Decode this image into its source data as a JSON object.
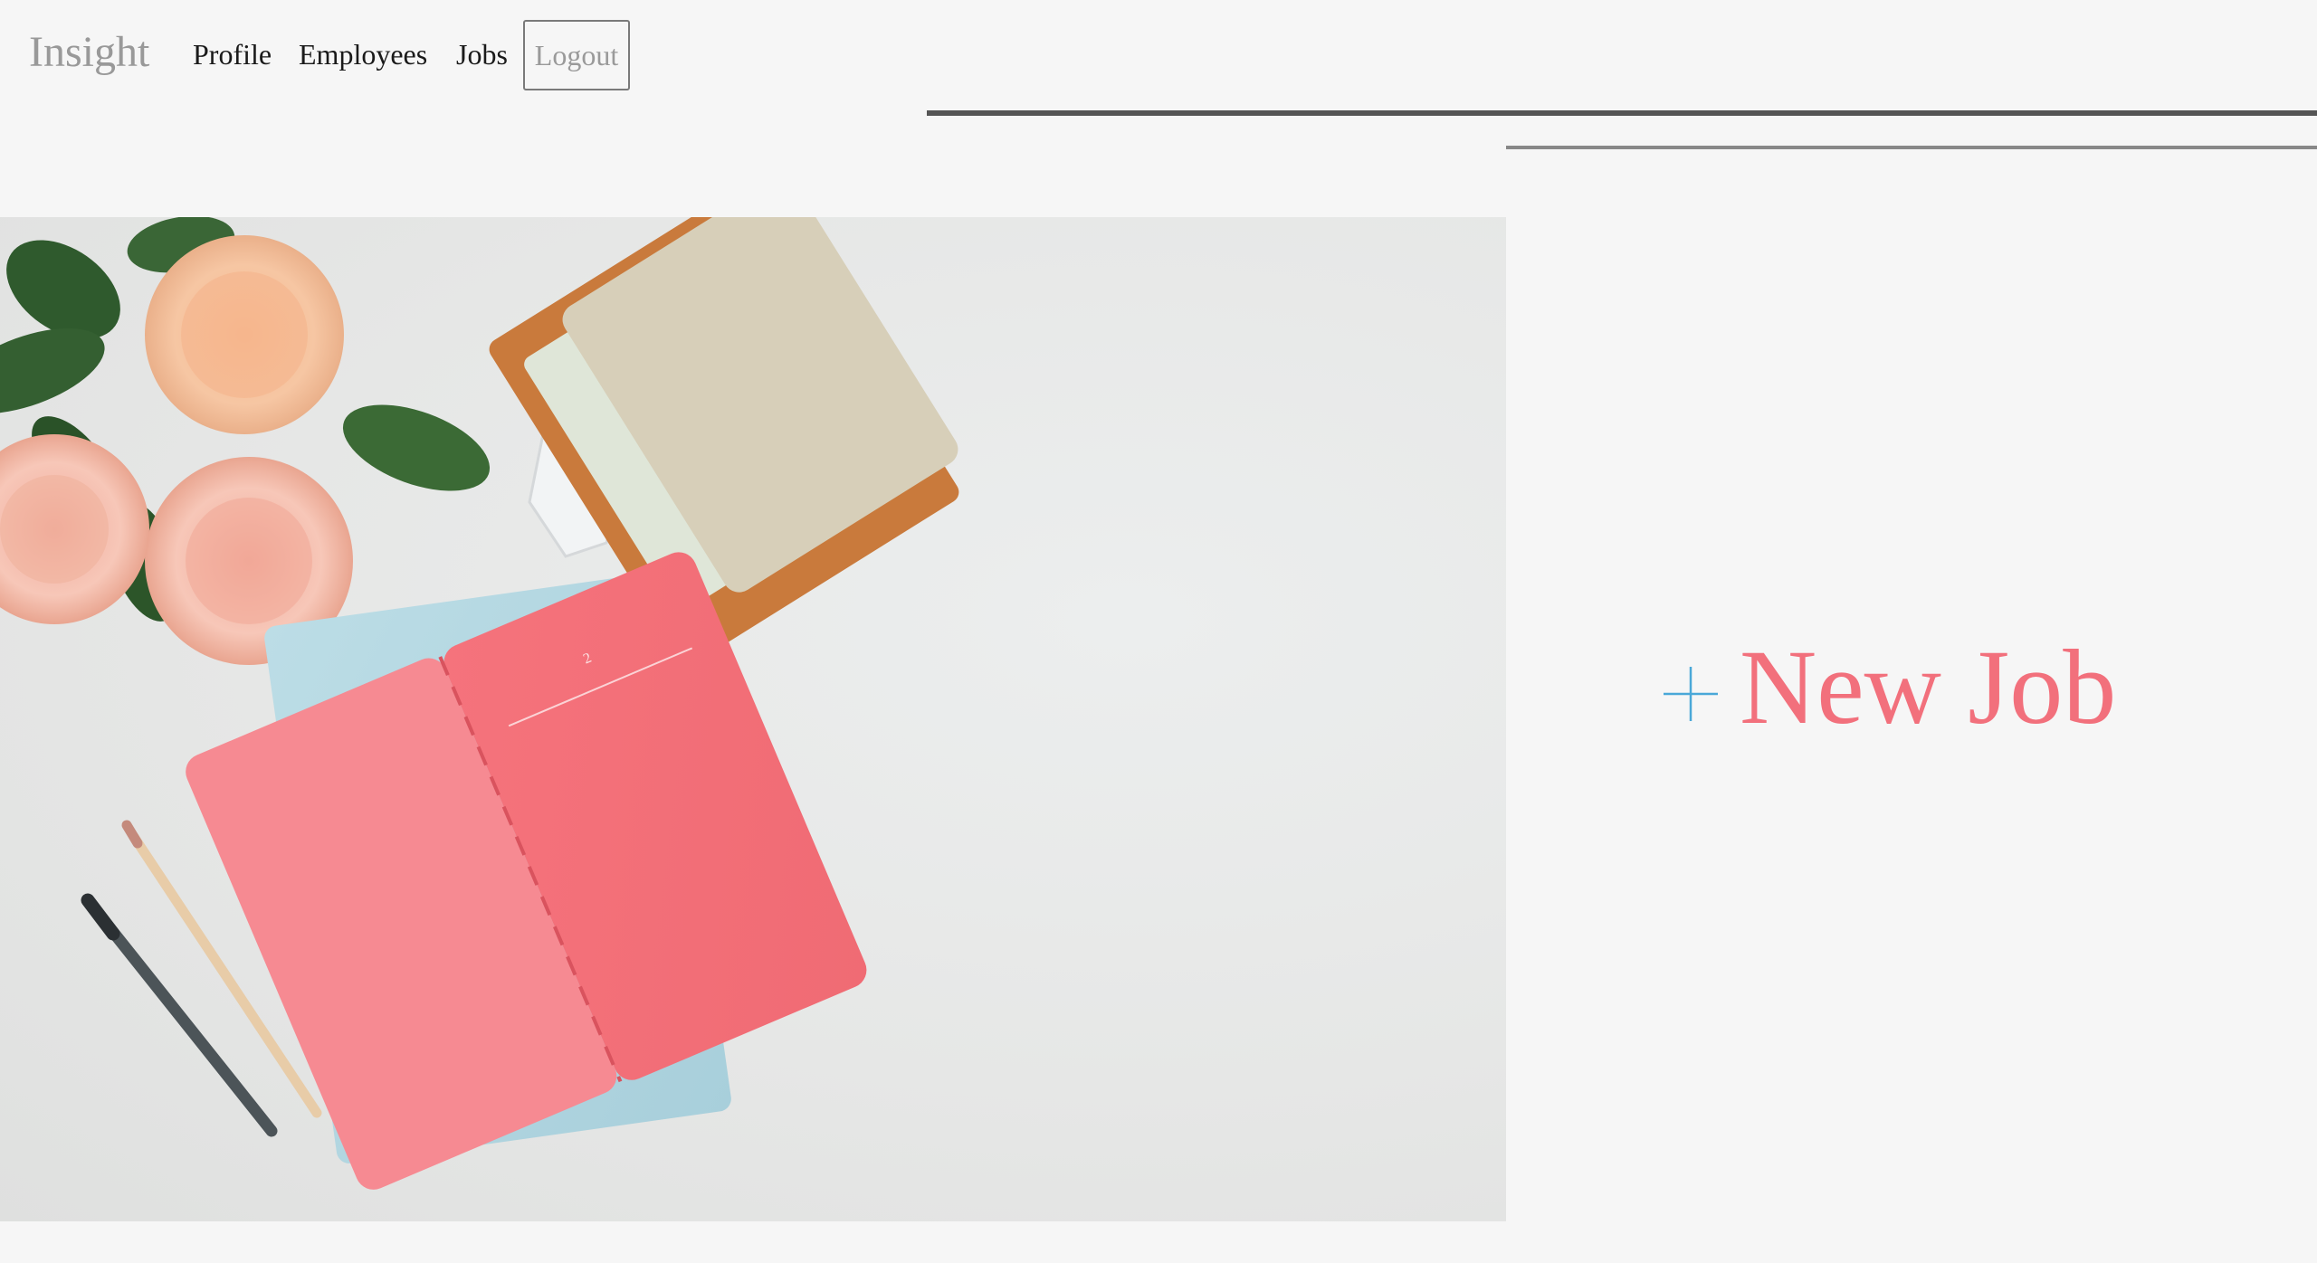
{
  "nav": {
    "brand": "Insight",
    "links": [
      {
        "label": "Profile"
      },
      {
        "label": "Employees"
      },
      {
        "label": "Jobs"
      }
    ],
    "logout_label": "Logout"
  },
  "hero": {
    "notebook_page_number": "2"
  },
  "cta": {
    "new_job_label": "New Job",
    "icon": "plus-icon"
  },
  "colors": {
    "accent_pink": "#f2707c",
    "plus_blue": "#4aa8d8",
    "brand_gray": "#999999"
  }
}
